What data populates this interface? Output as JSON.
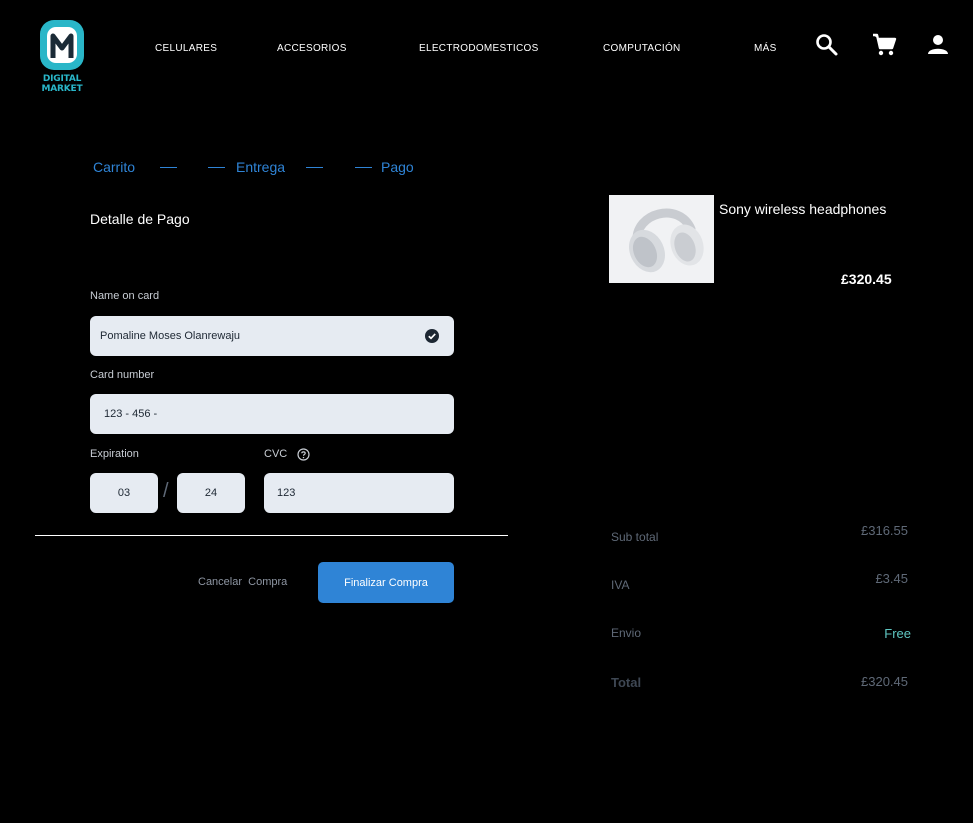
{
  "brand": {
    "logo_text": "DIGITAL MARKET",
    "accent_color": "#29b6c8"
  },
  "nav": {
    "items": [
      "CELULARES",
      "ACCESORIOS",
      "ELECTRODOMESTICOS",
      "COMPUTACIÓN",
      "MÁS"
    ],
    "icons": [
      "search-icon",
      "cart-icon",
      "user-icon"
    ]
  },
  "steps": [
    "Carrito",
    "Entrega",
    "Pago"
  ],
  "payment": {
    "title": "Detalle de Pago",
    "name_label": "Name on card",
    "name_value": "Pomaline Moses Olanrewaju",
    "card_label": "Card number",
    "card_value": "123 - 456 -",
    "exp_label": "Expiration",
    "exp_month": "03",
    "exp_separator": "/",
    "exp_year": "24",
    "cvc_label": "CVC",
    "cvc_value": "123",
    "cancel_label": "Cancelar  Compra",
    "submit_label": "Finalizar Compra"
  },
  "product": {
    "name": "Sony wireless headphones",
    "price": "£320.45"
  },
  "summary": {
    "subtotal_label": "Sub total",
    "subtotal_value": "£316.55",
    "iva_label": "IVA",
    "iva_value": "£3.45",
    "envio_label": "Envio",
    "envio_value": "Free",
    "total_label": "Total",
    "total_value": "£320.45"
  },
  "colors": {
    "primary": "#2f84d6",
    "free": "#5fc7c2",
    "field_bg": "#e6ebf2"
  }
}
